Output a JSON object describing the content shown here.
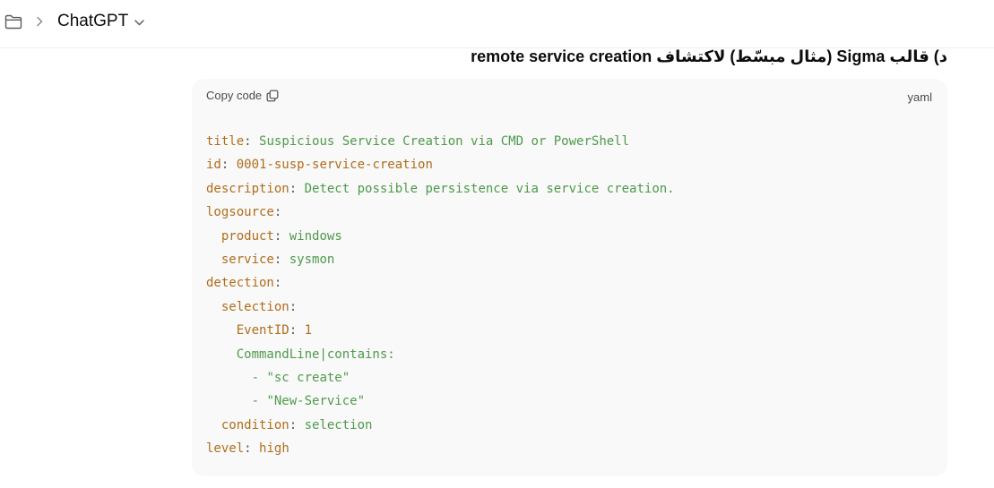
{
  "header": {
    "app_title": "ChatGPT",
    "icons": {
      "folder": "folder-icon",
      "breadcrumb": "chevron-right-icon",
      "dropdown": "chevron-down-icon"
    }
  },
  "message": {
    "heading": "د) قالب Sigma (مثال مبسّط) لاكتشاف remote service creation"
  },
  "code_block": {
    "copy_label": "Copy code",
    "language": "yaml",
    "lines": [
      {
        "indent": "",
        "key": "title",
        "value": "Suspicious Service Creation via CMD or PowerShell",
        "value_kind": "string"
      },
      {
        "indent": "",
        "key": "id",
        "value": "0001-susp-service-creation",
        "value_kind": "key"
      },
      {
        "indent": "",
        "key": "description",
        "value": "Detect possible persistence via service creation.",
        "value_kind": "string"
      },
      {
        "indent": "",
        "key": "logsource",
        "value": "",
        "value_kind": "string"
      },
      {
        "indent": "  ",
        "key": "product",
        "value": "windows",
        "value_kind": "string"
      },
      {
        "indent": "  ",
        "key": "service",
        "value": "sysmon",
        "value_kind": "string"
      },
      {
        "indent": "",
        "key": "detection",
        "value": "",
        "value_kind": "string"
      },
      {
        "indent": "  ",
        "key": "selection",
        "value": "",
        "value_kind": "string"
      },
      {
        "indent": "    ",
        "key": "EventID",
        "value": "1",
        "value_kind": "key"
      },
      {
        "indent": "    ",
        "key": "CommandLine|contains",
        "value": "",
        "value_kind": "string",
        "key_kind": "string"
      },
      {
        "indent": "      ",
        "list_item": "\"sc create\""
      },
      {
        "indent": "      ",
        "list_item": "\"New-Service\""
      },
      {
        "indent": "  ",
        "key": "condition",
        "value": "selection",
        "value_kind": "string"
      },
      {
        "indent": "",
        "key": "level",
        "value": "high",
        "value_kind": "key"
      }
    ]
  },
  "colors": {
    "yaml_key": "#b06d1a",
    "yaml_string": "#4e9a4a",
    "code_background": "#f9f9f9"
  }
}
